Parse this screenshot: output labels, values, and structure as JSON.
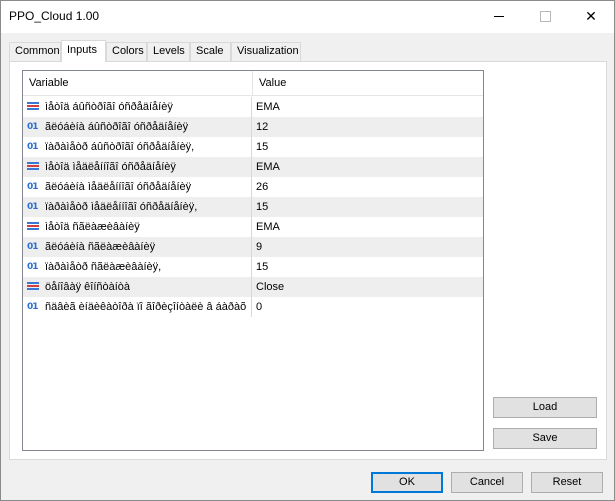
{
  "window": {
    "title": "PPO_Cloud 1.00",
    "close_glyph": "✕"
  },
  "tabs": [
    {
      "label": "Common"
    },
    {
      "label": "Inputs",
      "active": true
    },
    {
      "label": "Colors"
    },
    {
      "label": "Levels"
    },
    {
      "label": "Scale"
    },
    {
      "label": "Visualization"
    }
  ],
  "grid": {
    "headers": {
      "variable": "Variable",
      "value": "Value"
    },
    "rows": [
      {
        "icon": "list-icon",
        "variable": "ìåòîä áûñòðîãî óñðåäíåíèÿ",
        "value": "EMA"
      },
      {
        "icon": "number-icon",
        "variable": "ãëóáèíà áûñòðîãî óñðåäíåíèÿ",
        "value": "12"
      },
      {
        "icon": "number-icon",
        "variable": "ïàðàìåòð áûñòðîãî óñðåäíåíèÿ,",
        "value": "15"
      },
      {
        "icon": "list-icon",
        "variable": "ìåòîä ìåäëåííîãî óñðåäíåíèÿ",
        "value": "EMA"
      },
      {
        "icon": "number-icon",
        "variable": "ãëóáèíà ìåäëåííîãî óñðåäíåíèÿ",
        "value": "26"
      },
      {
        "icon": "number-icon",
        "variable": "ïàðàìåòð ìåäëåííîãî óñðåäíåíèÿ,",
        "value": "15"
      },
      {
        "icon": "list-icon",
        "variable": "ìåòîä ñãëàæèâàíèÿ",
        "value": "EMA"
      },
      {
        "icon": "number-icon",
        "variable": "ãëóáèíà ñãëàæèâàíèÿ",
        "value": "9"
      },
      {
        "icon": "number-icon",
        "variable": "ïàðàìåòð ñãëàæèâàíèÿ,",
        "value": "15"
      },
      {
        "icon": "list-icon",
        "variable": "öåíîâàÿ êîíñòàíòà",
        "value": "Close"
      },
      {
        "icon": "number-icon",
        "variable": "ñäâèã èíäèêàòîðà ïî ãîðèçîíòàëè â áàðàõ",
        "value": "0"
      }
    ]
  },
  "icons": {
    "number_glyph": "01"
  },
  "buttons": {
    "load": "Load",
    "save": "Save",
    "ok": "OK",
    "cancel": "Cancel",
    "reset": "Reset"
  }
}
